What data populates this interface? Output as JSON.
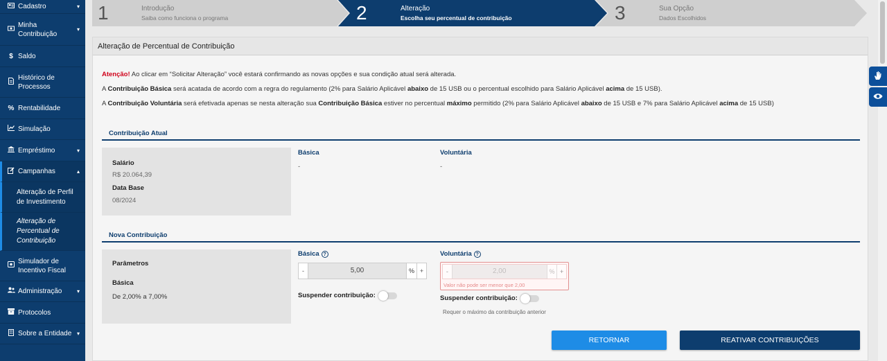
{
  "colors": {
    "sidebar": "#0d3d6e",
    "accent": "#1e8ce6",
    "danger": "#d0021b",
    "step_active": "#0d3d6e",
    "step_inactive": "#cfcfcf"
  },
  "sidebar": {
    "items": [
      {
        "icon": "id-card-icon",
        "label": "Cadastro",
        "caret": "▾"
      },
      {
        "icon": "money-icon",
        "label": "Minha Contribuição",
        "caret": "▾"
      },
      {
        "icon": "dollar-icon",
        "label": "Saldo",
        "caret": ""
      },
      {
        "icon": "document-icon",
        "label": "Histórico de Processos",
        "caret": ""
      },
      {
        "icon": "percent-icon",
        "label": "Rentabilidade",
        "caret": ""
      },
      {
        "icon": "chart-icon",
        "label": "Simulação",
        "caret": ""
      },
      {
        "icon": "bank-icon",
        "label": "Empréstimo",
        "caret": "▾"
      },
      {
        "icon": "edit-icon",
        "label": "Campanhas",
        "caret": "▴"
      }
    ],
    "sub_items": [
      {
        "label": "Alteração de Perfil de Investimento"
      },
      {
        "label": "Alteração de Percentual de Contribuição"
      }
    ],
    "items_after": [
      {
        "icon": "calculator-icon",
        "label": "Simulador de Incentivo Fiscal",
        "caret": ""
      },
      {
        "icon": "users-icon",
        "label": "Administração",
        "caret": "▾"
      },
      {
        "icon": "protocol-icon",
        "label": "Protocolos",
        "caret": ""
      },
      {
        "icon": "building-icon",
        "label": "Sobre a Entidade",
        "caret": "▾"
      }
    ]
  },
  "steps": [
    {
      "num": "1",
      "title": "Introdução",
      "subtitle": "Saiba como funciona o programa"
    },
    {
      "num": "2",
      "title": "Alteração",
      "subtitle": "Escolha seu percentual de contribuição"
    },
    {
      "num": "3",
      "title": "Sua Opção",
      "subtitle": "Dados Escolhidos"
    }
  ],
  "panel": {
    "title": "Alteração de Percentual de Contribuição",
    "notice1_red": "Atenção!",
    "notice1_rest": " Ao clicar em “Solicitar Alteração” você estará confirmando as novas opções e sua condição atual será alterada.",
    "notice2": [
      "A ",
      "Contribuição Básica",
      " será acatada de acordo com a regra do regulamento (2% para Salário Aplicável ",
      "abaixo",
      " de 15 USB ou o percentual escolhido para Salário Aplicável ",
      "acima",
      " de 15 USB)."
    ],
    "notice3": [
      "A ",
      "Contribuição Voluntária",
      " será efetivada apenas se nesta alteração sua ",
      "Contribuição Básica",
      " estiver no percentual ",
      "máximo",
      " permitido (2% para Salário Aplicável ",
      "abaixo",
      " de 15 USB e 7% para Salário Aplicável ",
      "acima",
      " de 15 USB)"
    ]
  },
  "current": {
    "section_title": "Contribuição Atual",
    "salario_label": "Salário",
    "salario_value": "R$ 20.064,39",
    "database_label": "Data Base",
    "database_value": "08/2024",
    "basica_label": "Básica",
    "basica_value": "-",
    "voluntaria_label": "Voluntária",
    "voluntaria_value": "-"
  },
  "nova": {
    "section_title": "Nova Contribuição",
    "params_label": "Parâmetros",
    "basica_label": "Básica",
    "basica_range": "De 2,00% a 7,00%",
    "basica_head": "Básica",
    "basica_input": "5,00",
    "voluntaria_head": "Voluntária",
    "voluntaria_input": "2,00",
    "voluntaria_error": "Valor não pode ser menor que 2,00",
    "unit": "%",
    "minus": "-",
    "plus": "+",
    "suspend_label": "Suspender contribuição:",
    "suspend_hint": "Requer o máximo da contribuição anterior",
    "help": "?"
  },
  "buttons": {
    "back": "RETORNAR",
    "reactivate": "REATIVAR CONTRIBUIÇÕES"
  }
}
